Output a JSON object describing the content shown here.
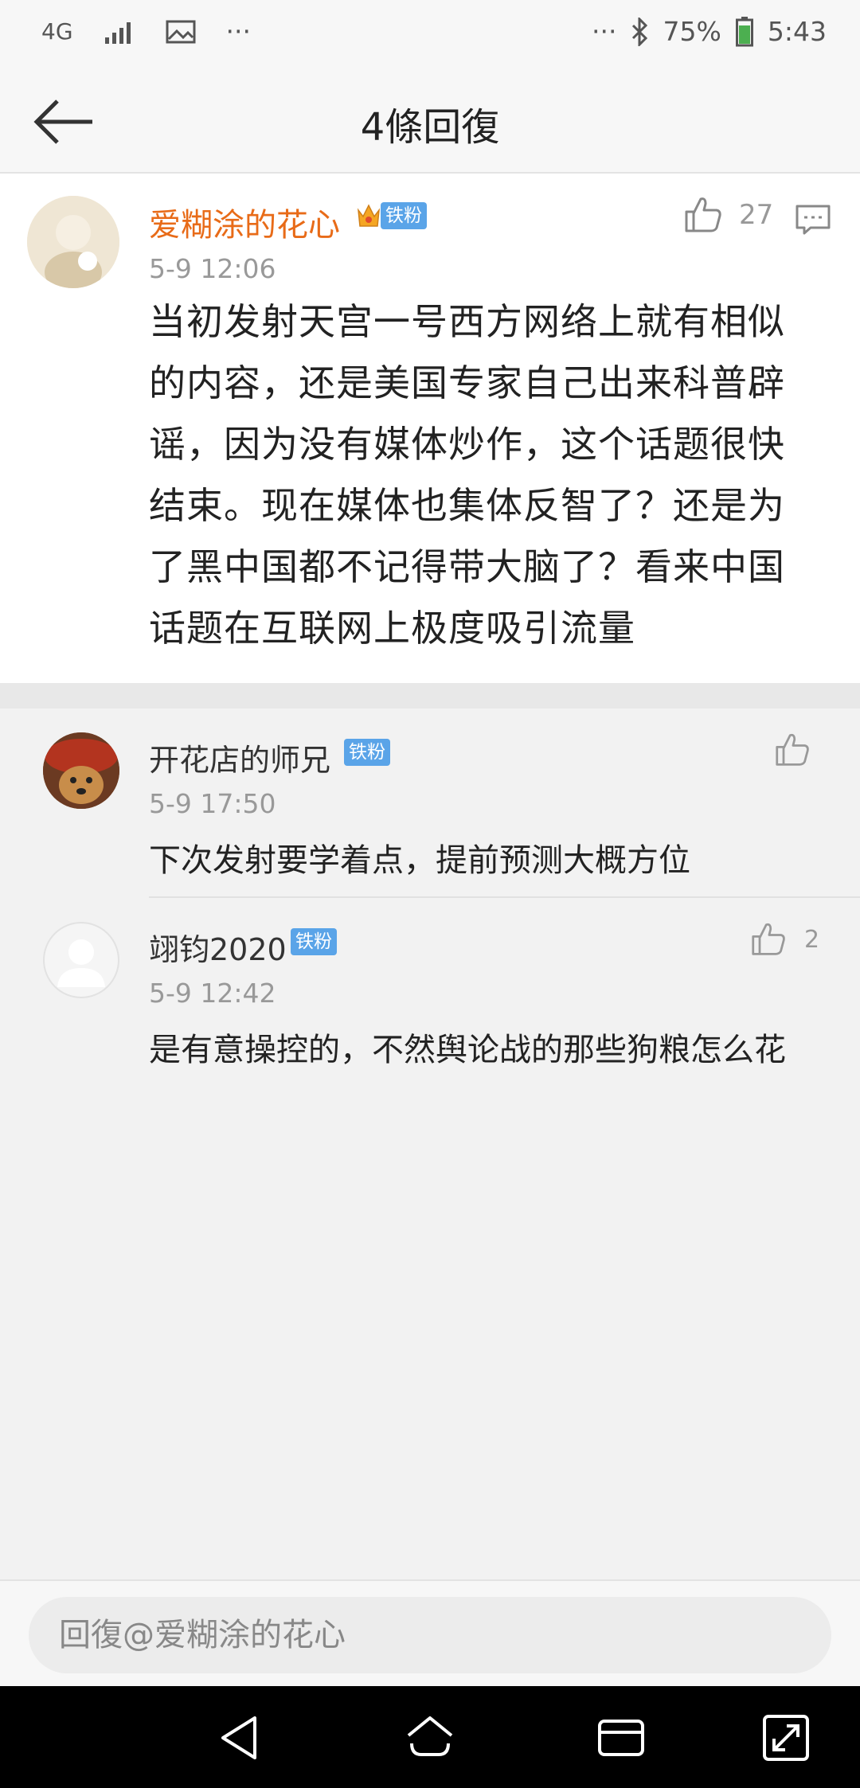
{
  "status_bar": {
    "network": "4G",
    "dots_left": "···",
    "dots_right": "···",
    "battery": "75%",
    "time": "5:43"
  },
  "header": {
    "title": "4條回復"
  },
  "main_comment": {
    "username": "爱糊涂的花心",
    "badge": "铁粉",
    "time": "5-9 12:06",
    "likes": "27",
    "text": "当初发射天宫一号西方网络上就有相似的内容，还是美国专家自己出来科普辟谣，因为没有媒体炒作，这个话题很快结束。现在媒体也集体反智了？还是为了黑中国都不记得带大脑了？看来中国话题在互联网上极度吸引流量"
  },
  "replies": [
    {
      "username": "开花店的师兄",
      "badge": "铁粉",
      "time": "5-9 17:50",
      "likes": "",
      "text": "下次发射要学着点，提前预测大概方位"
    },
    {
      "username": "翊钧2020",
      "badge": "铁粉",
      "time": "5-9 12:42",
      "likes": "2",
      "text": "是有意操控的，不然舆论战的那些狗粮怎么花"
    }
  ],
  "reply_box": {
    "placeholder": "回復@爱糊涂的花心"
  },
  "colors": {
    "username_highlight": "#e86b18",
    "badge_blue": "#5aa4e8"
  }
}
